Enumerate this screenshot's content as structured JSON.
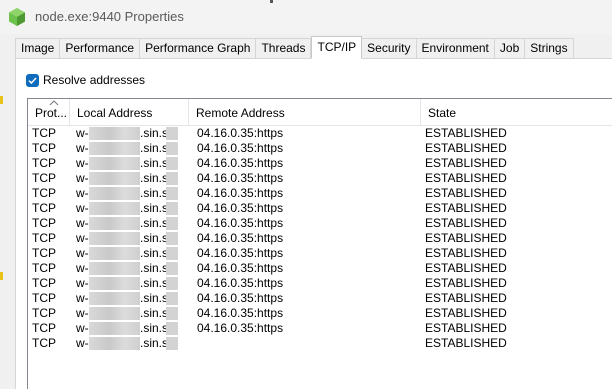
{
  "window": {
    "title": "node.exe:9440 Properties",
    "icon": "node-hexagon-icon"
  },
  "tabs": [
    {
      "label": "Image",
      "active": false
    },
    {
      "label": "Performance",
      "active": false
    },
    {
      "label": "Performance Graph",
      "active": false
    },
    {
      "label": "Threads",
      "active": false
    },
    {
      "label": "TCP/IP",
      "active": true
    },
    {
      "label": "Security",
      "active": false
    },
    {
      "label": "Environment",
      "active": false
    },
    {
      "label": "Job",
      "active": false
    },
    {
      "label": "Strings",
      "active": false
    }
  ],
  "options": {
    "resolve_addresses_label": "Resolve addresses",
    "resolve_addresses_checked": true
  },
  "table": {
    "columns": [
      "Prot...",
      "Local Address",
      "Remote Address",
      "State"
    ],
    "sort_column": "Prot...",
    "rows": [
      {
        "proto": "TCP",
        "local_prefix": "w-p",
        "local_suffix": ".sin.s",
        "remote": "04.16.0.35:https",
        "state": "ESTABLISHED"
      },
      {
        "proto": "TCP",
        "local_prefix": "w-p",
        "local_suffix": ".sin.s",
        "remote": "04.16.0.35:https",
        "state": "ESTABLISHED"
      },
      {
        "proto": "TCP",
        "local_prefix": "w-p",
        "local_suffix": ".sin.s",
        "remote": "04.16.0.35:https",
        "state": "ESTABLISHED"
      },
      {
        "proto": "TCP",
        "local_prefix": "w-p",
        "local_suffix": ".sin.s",
        "remote": "04.16.0.35:https",
        "state": "ESTABLISHED"
      },
      {
        "proto": "TCP",
        "local_prefix": "w-p",
        "local_suffix": ".sin.s",
        "remote": "04.16.0.35:https",
        "state": "ESTABLISHED"
      },
      {
        "proto": "TCP",
        "local_prefix": "w-p",
        "local_suffix": ".sin.s",
        "remote": "04.16.0.35:https",
        "state": "ESTABLISHED"
      },
      {
        "proto": "TCP",
        "local_prefix": "w-p",
        "local_suffix": ".sin.s",
        "remote": "04.16.0.35:https",
        "state": "ESTABLISHED"
      },
      {
        "proto": "TCP",
        "local_prefix": "w-p",
        "local_suffix": ".sin.s",
        "remote": "04.16.0.35:https",
        "state": "ESTABLISHED"
      },
      {
        "proto": "TCP",
        "local_prefix": "w-p",
        "local_suffix": ".sin.s",
        "remote": "04.16.0.35:https",
        "state": "ESTABLISHED"
      },
      {
        "proto": "TCP",
        "local_prefix": "w-p",
        "local_suffix": ".sin.s",
        "remote": "04.16.0.35:https",
        "state": "ESTABLISHED"
      },
      {
        "proto": "TCP",
        "local_prefix": "w-p",
        "local_suffix": ".sin.s",
        "remote": "04.16.0.35:https",
        "state": "ESTABLISHED"
      },
      {
        "proto": "TCP",
        "local_prefix": "w-p",
        "local_suffix": ".sin.s",
        "remote": "04.16.0.35:https",
        "state": "ESTABLISHED"
      },
      {
        "proto": "TCP",
        "local_prefix": "w-p",
        "local_suffix": ".sin.s",
        "remote": "04.16.0.35:https",
        "state": "ESTABLISHED"
      },
      {
        "proto": "TCP",
        "local_prefix": "w-p",
        "local_suffix": ".sin.s",
        "remote": "04.16.0.35:https",
        "state": "ESTABLISHED"
      },
      {
        "proto": "TCP",
        "local_prefix": "w-p",
        "local_suffix": ".sin.s",
        "remote": "",
        "state": "ESTABLISHED"
      }
    ]
  },
  "colors": {
    "accent": "#0f6cbd",
    "node_icon": "#6cc24a"
  }
}
